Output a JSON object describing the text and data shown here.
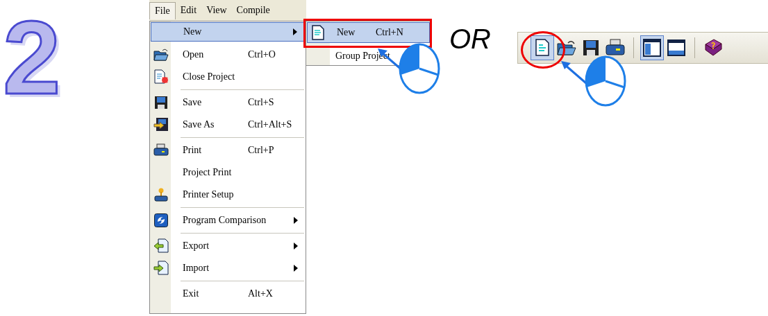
{
  "step_number": "2",
  "menu_bar": [
    {
      "label": "File",
      "selected": true
    },
    {
      "label": "Edit",
      "selected": false
    },
    {
      "label": "View",
      "selected": false
    },
    {
      "label": "Compile",
      "selected": false
    }
  ],
  "file_menu": [
    {
      "kind": "item",
      "label": "New",
      "submenu": true,
      "selected": true
    },
    {
      "kind": "item",
      "label": "Open",
      "shortcut": "Ctrl+O",
      "submenu": false,
      "selected": false
    },
    {
      "kind": "item",
      "label": "Close Project",
      "submenu": false,
      "selected": false
    },
    {
      "kind": "separator"
    },
    {
      "kind": "item",
      "label": "Save",
      "shortcut": "Ctrl+S",
      "submenu": false,
      "selected": false
    },
    {
      "kind": "item",
      "label": "Save As",
      "shortcut": "Ctrl+Alt+S",
      "submenu": false,
      "selected": false
    },
    {
      "kind": "separator"
    },
    {
      "kind": "item",
      "label": "Print",
      "shortcut": "Ctrl+P",
      "submenu": false,
      "selected": false
    },
    {
      "kind": "item",
      "label": "Project Print",
      "submenu": false,
      "selected": false
    },
    {
      "kind": "item",
      "label": "Printer Setup",
      "submenu": false,
      "selected": false
    },
    {
      "kind": "separator"
    },
    {
      "kind": "item",
      "label": "Program Comparison",
      "submenu": true,
      "selected": false
    },
    {
      "kind": "separator"
    },
    {
      "kind": "item",
      "label": "Export",
      "submenu": true,
      "selected": false
    },
    {
      "kind": "item",
      "label": "Import",
      "submenu": true,
      "selected": false
    },
    {
      "kind": "separator"
    },
    {
      "kind": "item",
      "label": "Exit",
      "shortcut": "Alt+X",
      "submenu": false,
      "selected": false
    }
  ],
  "new_submenu": [
    {
      "label": "New",
      "shortcut": "Ctrl+N",
      "selected": true
    },
    {
      "label": "Group Project",
      "selected": false
    }
  ],
  "or_label": "OR",
  "toolbar": [
    {
      "kind": "button",
      "pressed": true
    },
    {
      "kind": "button",
      "pressed": false
    },
    {
      "kind": "button",
      "pressed": false
    },
    {
      "kind": "button",
      "pressed": false
    },
    {
      "kind": "separator"
    },
    {
      "kind": "button",
      "pressed": true
    },
    {
      "kind": "button",
      "pressed": false
    },
    {
      "kind": "separator"
    },
    {
      "kind": "button",
      "pressed": false
    }
  ]
}
